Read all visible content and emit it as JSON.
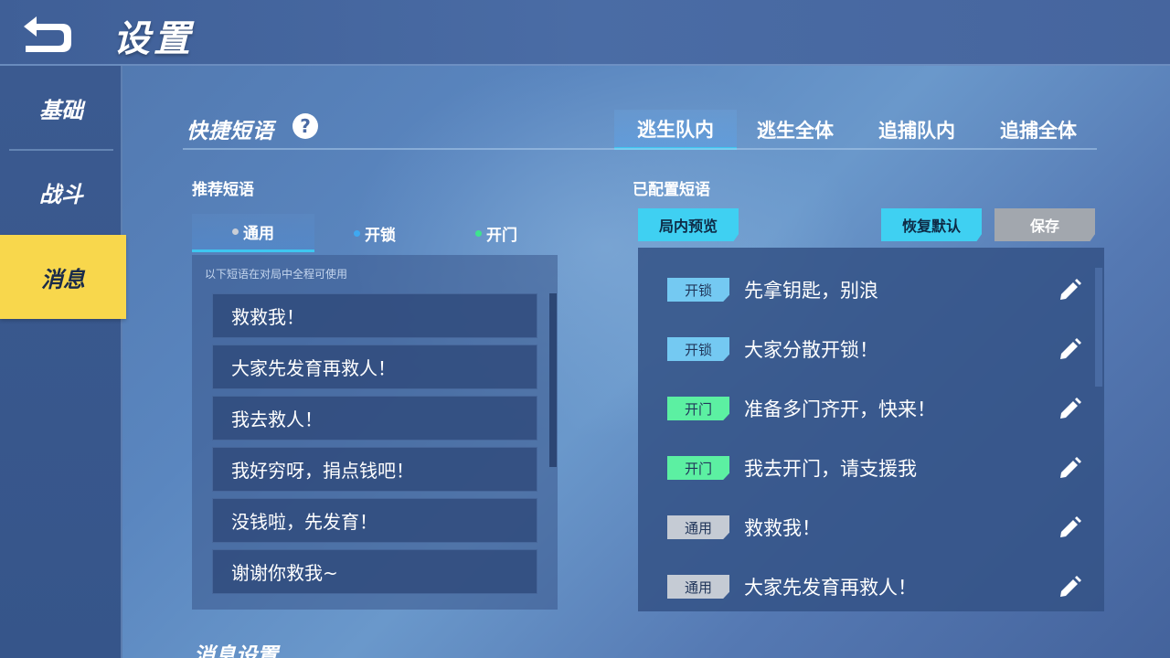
{
  "header": {
    "title": "设置",
    "back_icon": "back-arrow-icon"
  },
  "sidebar": {
    "items": [
      {
        "label": "基础",
        "active": false
      },
      {
        "label": "战斗",
        "active": false
      },
      {
        "label": "消息",
        "active": true
      }
    ]
  },
  "quick_phrases": {
    "title": "快捷短语",
    "help_label": "?",
    "tabs": [
      {
        "label": "逃生队内",
        "active": true
      },
      {
        "label": "逃生全体",
        "active": false
      },
      {
        "label": "追捕队内",
        "active": false
      },
      {
        "label": "追捕全体",
        "active": false
      }
    ]
  },
  "recommended": {
    "title": "推荐短语",
    "tabs": [
      {
        "label": "通用",
        "dot_color": "#c9ced6",
        "active": true
      },
      {
        "label": "开锁",
        "dot_color": "#3fa8f0",
        "active": false
      },
      {
        "label": "开门",
        "dot_color": "#3ee38e",
        "active": false
      }
    ],
    "hint": "以下短语在对局中全程可使用",
    "phrases": [
      "救救我！",
      "大家先发育再救人！",
      "我去救人！",
      "我好穷呀，捐点钱吧！",
      "没钱啦，先发育！",
      "谢谢你救我~"
    ]
  },
  "configured": {
    "title": "已配置短语",
    "preview_label": "局内预览",
    "reset_label": "恢复默认",
    "save_label": "保存",
    "items": [
      {
        "tag": "开锁",
        "tag_type": "unlock",
        "text": "先拿钥匙，别浪"
      },
      {
        "tag": "开锁",
        "tag_type": "unlock",
        "text": "大家分散开锁！"
      },
      {
        "tag": "开门",
        "tag_type": "open",
        "text": "准备多门齐开，快来！"
      },
      {
        "tag": "开门",
        "tag_type": "open",
        "text": "我去开门，请支援我"
      },
      {
        "tag": "通用",
        "tag_type": "general",
        "text": "救救我！"
      },
      {
        "tag": "通用",
        "tag_type": "general",
        "text": "大家先发育再救人！"
      }
    ]
  },
  "message_settings": {
    "title": "消息设置"
  },
  "colors": {
    "accent_cyan": "#3fd0f2",
    "sidebar_active": "#f8d74c",
    "tag_unlock": "#74c9f2",
    "tag_open": "#5cf0a2",
    "tag_general": "#c5cbd4",
    "save_disabled": "#a2a7ae"
  },
  "icons": {
    "edit": "pencil-icon",
    "help": "question-icon"
  }
}
